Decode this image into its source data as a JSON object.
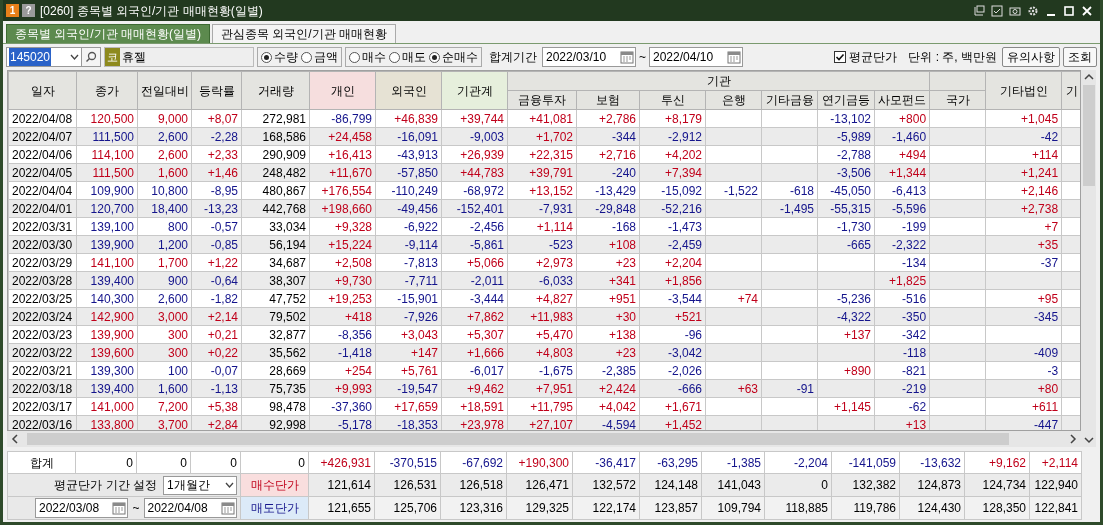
{
  "window": {
    "title": "[0260] 종목별 외국인/기관 매매현황(일별)",
    "badge_number": "1",
    "badge_help": "?"
  },
  "tabs": [
    {
      "label": "종목별 외국인/기관 매매현황(일별)",
      "selected": true
    },
    {
      "label": "관심종목 외국인/기관 매매현황",
      "selected": false
    }
  ],
  "toolbar": {
    "stock_code": "145020",
    "market_badge": "코",
    "stock_name": "휴젤",
    "unit_options": [
      {
        "label": "수량",
        "selected": true
      },
      {
        "label": "금액",
        "selected": false
      }
    ],
    "trade_options": [
      {
        "label": "매수",
        "selected": false
      },
      {
        "label": "매도",
        "selected": false
      },
      {
        "label": "순매수",
        "selected": true
      }
    ],
    "period_label": "합계기간",
    "period_from": "2022/03/10",
    "period_separator": "~",
    "period_to": "2022/04/10",
    "avg_price": {
      "label": "평균단가",
      "checked": true
    },
    "unit_text": "단위 : 주, 백만원",
    "buttons": [
      "유의사항",
      "조회"
    ]
  },
  "table": {
    "group_header": "기관",
    "columns": [
      {
        "label": "일자"
      },
      {
        "label": "종가"
      },
      {
        "label": "전일대비"
      },
      {
        "label": "등락률"
      },
      {
        "label": "거래량"
      },
      {
        "label": "개인",
        "kind": "individual"
      },
      {
        "label": "외국인",
        "kind": "foreign"
      },
      {
        "label": "기관계",
        "kind": "institution"
      },
      {
        "label": "금융투자",
        "group": true
      },
      {
        "label": "보험",
        "group": true
      },
      {
        "label": "투신",
        "group": true
      },
      {
        "label": "은행",
        "group": true
      },
      {
        "label": "기타금융",
        "group": true
      },
      {
        "label": "연기금등",
        "group": true
      },
      {
        "label": "사모펀드",
        "group": true
      },
      {
        "label": "국가"
      },
      {
        "label": "기타법인"
      },
      {
        "label": "기"
      }
    ],
    "rows": [
      {
        "rising": true,
        "cells": [
          "2022/04/08",
          "120,500",
          "9,000",
          "+8,07",
          "272,981",
          "-86,799",
          "+46,839",
          "+39,744",
          "+41,081",
          "+2,786",
          "+8,179",
          null,
          null,
          "-13,102",
          "+800",
          null,
          "+1,045"
        ]
      },
      {
        "rising": false,
        "cells": [
          "2022/04/07",
          "111,500",
          "2,600",
          "-2,28",
          "168,586",
          "+24,458",
          "-16,091",
          "-9,003",
          "+1,702",
          "-344",
          "-2,912",
          null,
          null,
          "-5,989",
          "-1,460",
          null,
          "-42"
        ]
      },
      {
        "rising": true,
        "cells": [
          "2022/04/06",
          "114,100",
          "2,600",
          "+2,33",
          "290,909",
          "+16,413",
          "-43,913",
          "+26,939",
          "+22,315",
          "+2,716",
          "+4,202",
          null,
          null,
          "-2,788",
          "+494",
          null,
          "+114"
        ]
      },
      {
        "rising": true,
        "cells": [
          "2022/04/05",
          "111,500",
          "1,600",
          "+1,46",
          "248,482",
          "+11,670",
          "-57,850",
          "+44,783",
          "+39,791",
          "-240",
          "+7,394",
          null,
          null,
          "-3,506",
          "+1,344",
          null,
          "+1,241"
        ]
      },
      {
        "rising": false,
        "cells": [
          "2022/04/04",
          "109,900",
          "10,800",
          "-8,95",
          "480,867",
          "+176,554",
          "-110,249",
          "-68,972",
          "+13,152",
          "-13,429",
          "-15,092",
          "-1,522",
          "-618",
          "-45,050",
          "-6,413",
          null,
          "+2,146"
        ]
      },
      {
        "rising": false,
        "cells": [
          "2022/04/01",
          "120,700",
          "18,400",
          "-13,23",
          "442,768",
          "+198,660",
          "-49,456",
          "-152,401",
          "-7,931",
          "-29,848",
          "-52,216",
          null,
          "-1,495",
          "-55,315",
          "-5,596",
          null,
          "+2,738"
        ]
      },
      {
        "rising": false,
        "cells": [
          "2022/03/31",
          "139,100",
          "800",
          "-0,57",
          "33,034",
          "+9,328",
          "-6,922",
          "-2,456",
          "+1,114",
          "-168",
          "-1,473",
          null,
          null,
          "-1,730",
          "-199",
          null,
          "+7"
        ]
      },
      {
        "rising": false,
        "cells": [
          "2022/03/30",
          "139,900",
          "1,200",
          "-0,85",
          "56,194",
          "+15,224",
          "-9,114",
          "-5,861",
          "-523",
          "+108",
          "-2,459",
          null,
          null,
          "-665",
          "-2,322",
          null,
          "+35"
        ]
      },
      {
        "rising": true,
        "cells": [
          "2022/03/29",
          "141,100",
          "1,700",
          "+1,22",
          "34,687",
          "+2,508",
          "-7,813",
          "+5,066",
          "+2,973",
          "+23",
          "+2,204",
          null,
          null,
          null,
          "-134",
          null,
          "-37"
        ]
      },
      {
        "rising": false,
        "cells": [
          "2022/03/28",
          "139,400",
          "900",
          "-0,64",
          "38,307",
          "+9,730",
          "-7,711",
          "-2,011",
          "-6,033",
          "+341",
          "+1,856",
          null,
          null,
          null,
          "+1,825",
          null,
          null
        ]
      },
      {
        "rising": false,
        "cells": [
          "2022/03/25",
          "140,300",
          "2,600",
          "-1,82",
          "47,752",
          "+19,253",
          "-15,901",
          "-3,444",
          "+4,827",
          "+951",
          "-3,544",
          "+74",
          null,
          "-5,236",
          "-516",
          null,
          "+95"
        ]
      },
      {
        "rising": true,
        "cells": [
          "2022/03/24",
          "142,900",
          "3,000",
          "+2,14",
          "79,502",
          "+418",
          "-7,926",
          "+7,862",
          "+11,983",
          "+30",
          "+521",
          null,
          null,
          "-4,322",
          "-350",
          null,
          "-345"
        ]
      },
      {
        "rising": true,
        "cells": [
          "2022/03/23",
          "139,900",
          "300",
          "+0,21",
          "32,877",
          "-8,356",
          "+3,043",
          "+5,307",
          "+5,470",
          "+138",
          "-96",
          null,
          null,
          "+137",
          "-342",
          null,
          null
        ]
      },
      {
        "rising": true,
        "cells": [
          "2022/03/22",
          "139,600",
          "300",
          "+0,22",
          "35,562",
          "-1,418",
          "+147",
          "+1,666",
          "+4,803",
          "+23",
          "-3,042",
          null,
          null,
          null,
          "-118",
          null,
          "-409"
        ]
      },
      {
        "rising": false,
        "cells": [
          "2022/03/21",
          "139,300",
          "100",
          "-0,07",
          "28,669",
          "+254",
          "+5,761",
          "-6,017",
          "-1,675",
          "-2,385",
          "-2,026",
          null,
          null,
          "+890",
          "-821",
          null,
          "-3"
        ]
      },
      {
        "rising": false,
        "cells": [
          "2022/03/18",
          "139,400",
          "1,600",
          "-1,13",
          "75,735",
          "+9,993",
          "-19,547",
          "+9,462",
          "+7,951",
          "+2,424",
          "-666",
          "+63",
          "-91",
          null,
          "-219",
          null,
          "+80"
        ]
      },
      {
        "rising": true,
        "cells": [
          "2022/03/17",
          "141,000",
          "7,200",
          "+5,38",
          "98,478",
          "-37,360",
          "+17,659",
          "+18,591",
          "+11,795",
          "+4,042",
          "+1,671",
          null,
          null,
          "+1,145",
          "-62",
          null,
          "+611"
        ]
      },
      {
        "rising": true,
        "cells": [
          "2022/03/16",
          "133,800",
          "3,700",
          "+2,84",
          "92,998",
          "-5,178",
          "-18,353",
          "+23,978",
          "+27,107",
          "-4,594",
          "+1,452",
          null,
          null,
          null,
          "+13",
          null,
          "-447"
        ]
      }
    ]
  },
  "totals": {
    "label": "합계",
    "values": [
      "0",
      "0",
      "0",
      "0",
      "+426,931",
      "-370,515",
      "-67,692",
      "+190,300",
      "-36,417",
      "-63,295",
      "-1,385",
      "-2,204",
      "-141,059",
      "-13,632",
      "+9,162",
      "+2,114"
    ]
  },
  "average": {
    "label": "평균단가 기간 설정",
    "period": "1개월간",
    "from": "2022/03/08",
    "separator": "~",
    "to": "2022/04/08",
    "buy": {
      "label": "매수단가",
      "values": [
        "121,614",
        "126,531",
        "126,518",
        "126,471",
        "132,572",
        "124,148",
        "141,043",
        "0",
        "132,382",
        "124,873",
        "124,734",
        "122,940"
      ]
    },
    "sell": {
      "label": "매도단가",
      "values": [
        "121,655",
        "125,706",
        "123,316",
        "129,325",
        "122,174",
        "123,857",
        "109,794",
        "118,885",
        "119,786",
        "124,430",
        "128,350",
        "122,841"
      ]
    }
  }
}
